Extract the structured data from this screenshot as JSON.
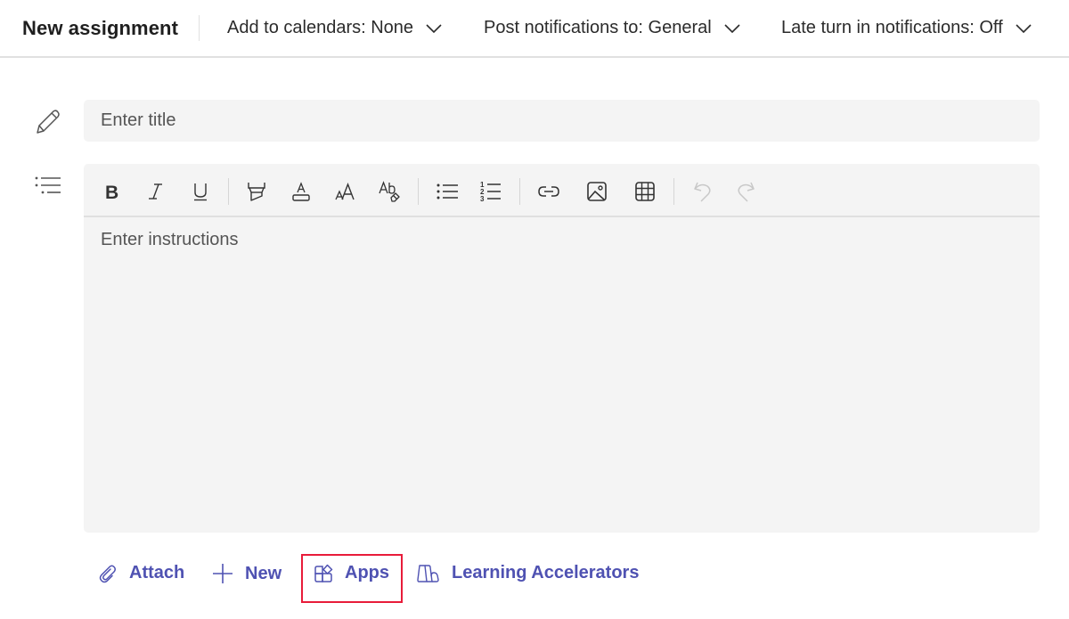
{
  "header": {
    "title": "New assignment",
    "dropdowns": [
      {
        "label": "Add to calendars: None",
        "icon": "chevron-down-icon"
      },
      {
        "label": "Post notifications to: General",
        "icon": "chevron-down-icon"
      },
      {
        "label": "Late turn in notifications: Off",
        "icon": "chevron-down-icon"
      }
    ]
  },
  "form": {
    "title_placeholder": "Enter title",
    "title_value": "",
    "instructions_placeholder": "Enter instructions",
    "side_icons": [
      "pencil-icon",
      "details-list-icon"
    ]
  },
  "toolbar": {
    "buttons": [
      {
        "name": "bold",
        "icon": "bold-icon",
        "enabled": true
      },
      {
        "name": "italic",
        "icon": "italic-icon",
        "enabled": true
      },
      {
        "name": "underline",
        "icon": "underline-icon",
        "enabled": true
      },
      {
        "name": "highlight",
        "icon": "highlighter-icon",
        "enabled": true
      },
      {
        "name": "font-color",
        "icon": "font-color-icon",
        "enabled": true
      },
      {
        "name": "font-size",
        "icon": "font-size-icon",
        "enabled": true
      },
      {
        "name": "clear-formatting",
        "icon": "clear-formatting-icon",
        "enabled": true
      },
      {
        "name": "bulleted-list",
        "icon": "bullet-list-icon",
        "enabled": true
      },
      {
        "name": "numbered-list",
        "icon": "numbered-list-icon",
        "enabled": true
      },
      {
        "name": "link",
        "icon": "link-icon",
        "enabled": true
      },
      {
        "name": "image",
        "icon": "image-icon",
        "enabled": true
      },
      {
        "name": "table",
        "icon": "table-icon",
        "enabled": true
      },
      {
        "name": "undo",
        "icon": "undo-icon",
        "enabled": false
      },
      {
        "name": "redo",
        "icon": "redo-icon",
        "enabled": false
      }
    ]
  },
  "actions": {
    "attach": "Attach",
    "new": "New",
    "apps": "Apps",
    "learning_accelerators": "Learning Accelerators",
    "highlighted": "Apps"
  },
  "colors": {
    "accent": "#4f52b2",
    "highlight_border": "#e81c3a",
    "field_background": "#f4f4f4",
    "disabled_icon": "#c8c8c8"
  }
}
